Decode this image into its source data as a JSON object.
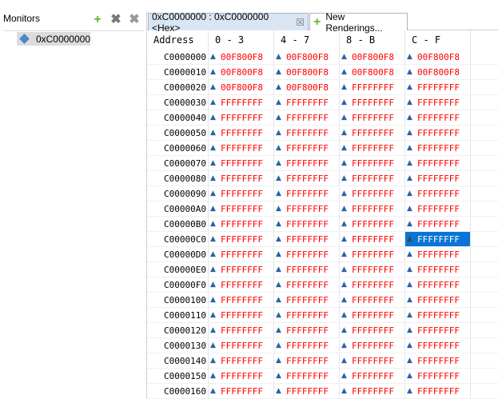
{
  "monitors": {
    "title": "Monitors",
    "items": [
      {
        "label": "0xC0000000"
      }
    ]
  },
  "tabs": [
    {
      "label": "0xC0000000 : 0xC0000000 <Hex>"
    },
    {
      "label": "New Renderings..."
    }
  ],
  "columns": [
    "Address",
    "0 - 3",
    "4 - 7",
    "8 - B",
    "C - F"
  ],
  "rows": [
    [
      "C0000000",
      "00F800F8",
      "00F800F8",
      "00F800F8",
      "00F800F8"
    ],
    [
      "C0000010",
      "00F800F8",
      "00F800F8",
      "00F800F8",
      "00F800F8"
    ],
    [
      "C0000020",
      "00F800F8",
      "00F800F8",
      "FFFFFFFF",
      "FFFFFFFF"
    ],
    [
      "C0000030",
      "FFFFFFFF",
      "FFFFFFFF",
      "FFFFFFFF",
      "FFFFFFFF"
    ],
    [
      "C0000040",
      "FFFFFFFF",
      "FFFFFFFF",
      "FFFFFFFF",
      "FFFFFFFF"
    ],
    [
      "C0000050",
      "FFFFFFFF",
      "FFFFFFFF",
      "FFFFFFFF",
      "FFFFFFFF"
    ],
    [
      "C0000060",
      "FFFFFFFF",
      "FFFFFFFF",
      "FFFFFFFF",
      "FFFFFFFF"
    ],
    [
      "C0000070",
      "FFFFFFFF",
      "FFFFFFFF",
      "FFFFFFFF",
      "FFFFFFFF"
    ],
    [
      "C0000080",
      "FFFFFFFF",
      "FFFFFFFF",
      "FFFFFFFF",
      "FFFFFFFF"
    ],
    [
      "C0000090",
      "FFFFFFFF",
      "FFFFFFFF",
      "FFFFFFFF",
      "FFFFFFFF"
    ],
    [
      "C00000A0",
      "FFFFFFFF",
      "FFFFFFFF",
      "FFFFFFFF",
      "FFFFFFFF"
    ],
    [
      "C00000B0",
      "FFFFFFFF",
      "FFFFFFFF",
      "FFFFFFFF",
      "FFFFFFFF"
    ],
    [
      "C00000C0",
      "FFFFFFFF",
      "FFFFFFFF",
      "FFFFFFFF",
      "FFFFFFFF"
    ],
    [
      "C00000D0",
      "FFFFFFFF",
      "FFFFFFFF",
      "FFFFFFFF",
      "FFFFFFFF"
    ],
    [
      "C00000E0",
      "FFFFFFFF",
      "FFFFFFFF",
      "FFFFFFFF",
      "FFFFFFFF"
    ],
    [
      "C00000F0",
      "FFFFFFFF",
      "FFFFFFFF",
      "FFFFFFFF",
      "FFFFFFFF"
    ],
    [
      "C0000100",
      "FFFFFFFF",
      "FFFFFFFF",
      "FFFFFFFF",
      "FFFFFFFF"
    ],
    [
      "C0000110",
      "FFFFFFFF",
      "FFFFFFFF",
      "FFFFFFFF",
      "FFFFFFFF"
    ],
    [
      "C0000120",
      "FFFFFFFF",
      "FFFFFFFF",
      "FFFFFFFF",
      "FFFFFFFF"
    ],
    [
      "C0000130",
      "FFFFFFFF",
      "FFFFFFFF",
      "FFFFFFFF",
      "FFFFFFFF"
    ],
    [
      "C0000140",
      "FFFFFFFF",
      "FFFFFFFF",
      "FFFFFFFF",
      "FFFFFFFF"
    ],
    [
      "C0000150",
      "FFFFFFFF",
      "FFFFFFFF",
      "FFFFFFFF",
      "FFFFFFFF"
    ],
    [
      "C0000160",
      "FFFFFFFF",
      "FFFFFFFF",
      "FFFFFFFF",
      "FFFFFFFF"
    ]
  ],
  "selected": {
    "row": 12,
    "col": 4
  },
  "colors": {
    "value": "#ff0000",
    "selection": "#0a74d6"
  }
}
